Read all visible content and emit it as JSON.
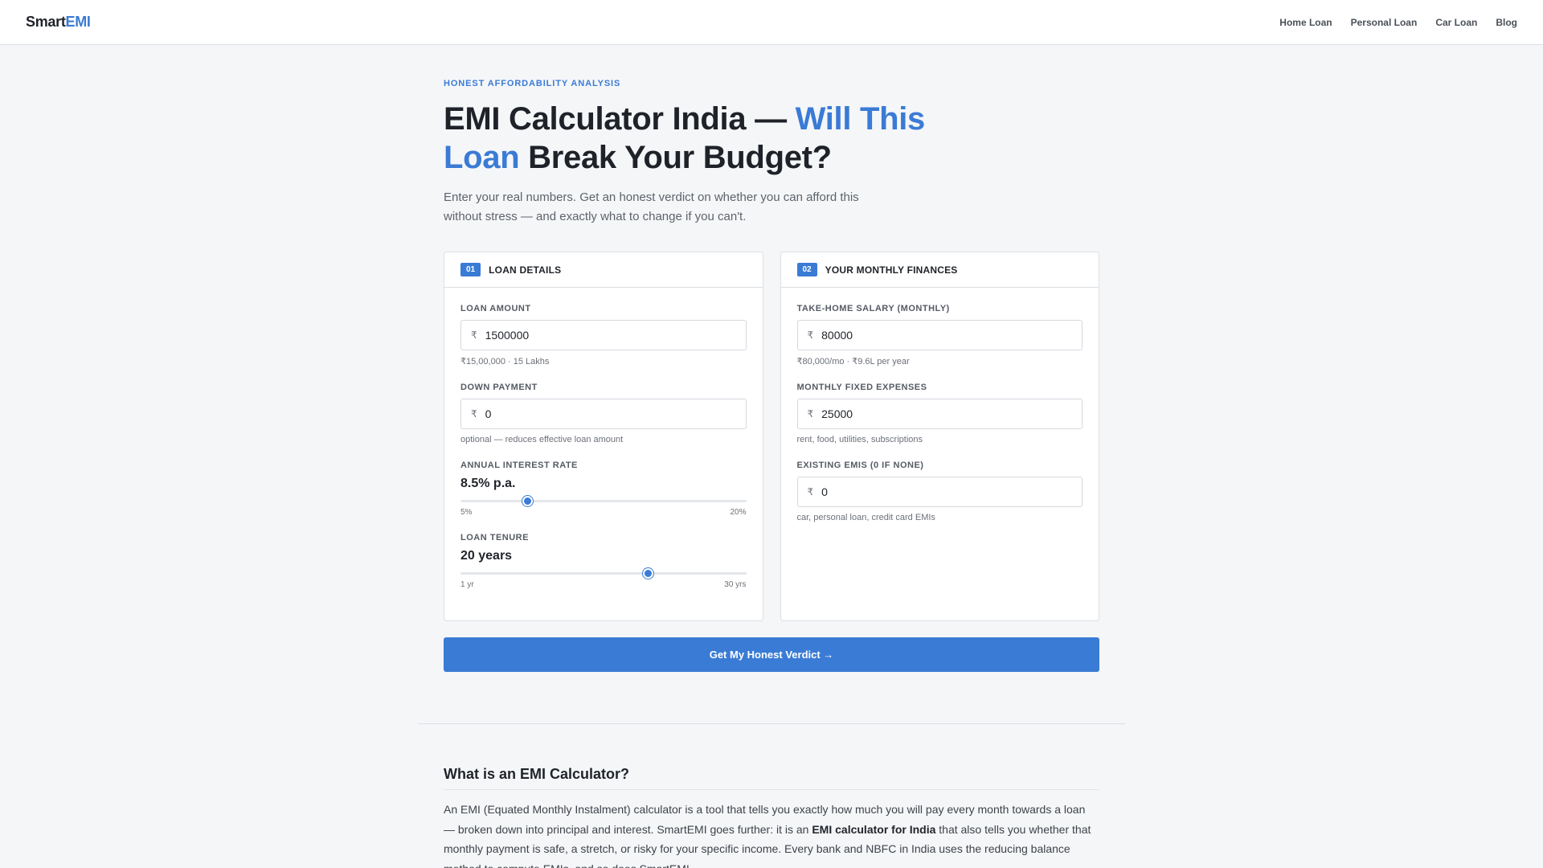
{
  "header": {
    "logo_part1": "Smart",
    "logo_part2": "EMI",
    "nav": [
      "Home Loan",
      "Personal Loan",
      "Car Loan",
      "Blog"
    ]
  },
  "hero": {
    "eyebrow": "HONEST AFFORDABILITY ANALYSIS",
    "title_part1": "EMI Calculator India — ",
    "title_highlight": "Will This Loan",
    "title_part2": " Break Your Budget?",
    "subtitle": "Enter your real numbers. Get an honest verdict on whether you can afford this without stress — and exactly what to change if you can't."
  },
  "loan_card": {
    "badge": "01",
    "title": "LOAN DETAILS",
    "loan_amount": {
      "label": "LOAN AMOUNT",
      "currency": "₹",
      "value": "1500000",
      "hint": "₹15,00,000 · 15 Lakhs"
    },
    "down_payment": {
      "label": "DOWN PAYMENT",
      "currency": "₹",
      "value": "0",
      "hint": "optional — reduces effective loan amount"
    },
    "interest_rate": {
      "label": "ANNUAL INTEREST RATE",
      "display": "8.5% p.a.",
      "value": 8.5,
      "min": 5,
      "max": 20,
      "min_label": "5%",
      "max_label": "20%"
    },
    "tenure": {
      "label": "LOAN TENURE",
      "display": "20 years",
      "value": 20,
      "min": 1,
      "max": 30,
      "min_label": "1 yr",
      "max_label": "30 yrs"
    }
  },
  "finance_card": {
    "badge": "02",
    "title": "YOUR MONTHLY FINANCES",
    "salary": {
      "label": "TAKE-HOME SALARY (MONTHLY)",
      "currency": "₹",
      "value": "80000",
      "hint": "₹80,000/mo · ₹9.6L per year"
    },
    "expenses": {
      "label": "MONTHLY FIXED EXPENSES",
      "currency": "₹",
      "value": "25000",
      "hint": "rent, food, utilities, subscriptions"
    },
    "emis": {
      "label": "EXISTING EMIS (0 IF NONE)",
      "currency": "₹",
      "value": "0",
      "hint": "car, personal loan, credit card EMIs"
    }
  },
  "cta_label": "Get My Honest Verdict →",
  "info": {
    "heading": "What is an EMI Calculator?",
    "para_part1": "An EMI (Equated Monthly Instalment) calculator is a tool that tells you exactly how much you will pay every month towards a loan — broken down into principal and interest. SmartEMI goes further: it is an ",
    "para_bold": "EMI calculator for India",
    "para_part2": " that also tells you whether that monthly payment is safe, a stretch, or risky for your specific income. Every bank and NBFC in India uses the reducing balance method to compute EMIs, and so does SmartEMI."
  }
}
